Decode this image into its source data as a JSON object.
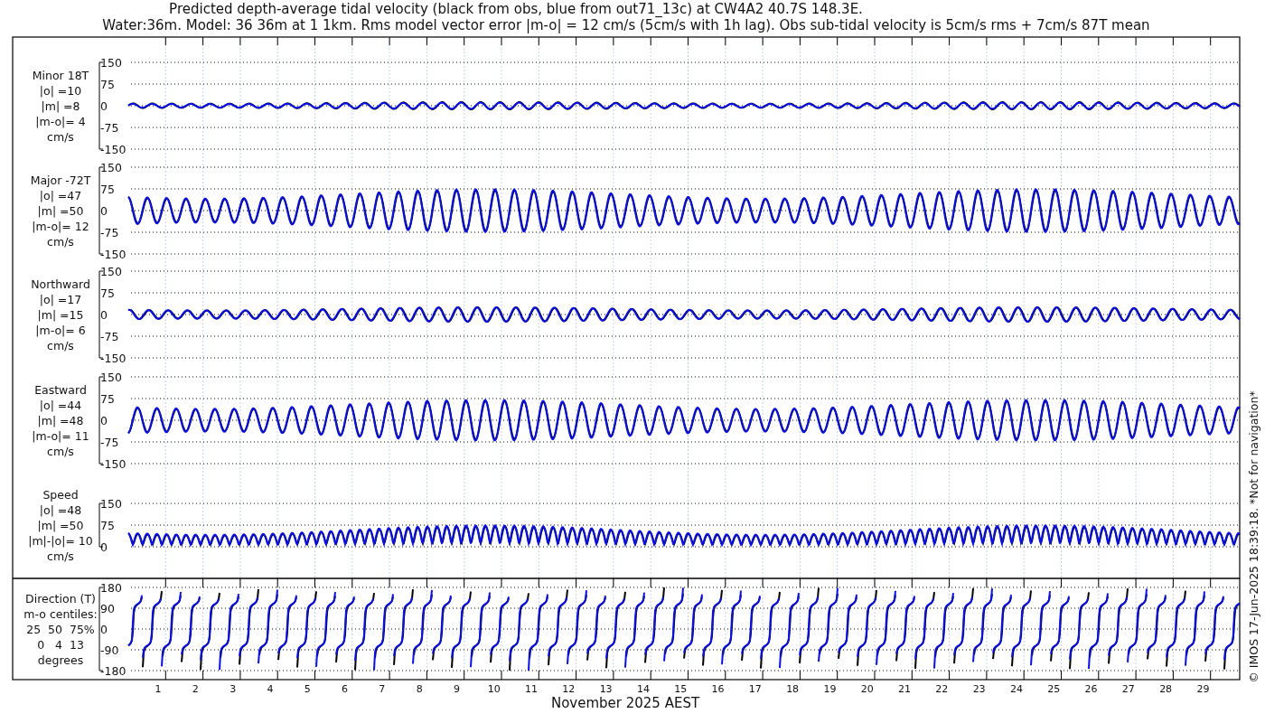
{
  "title": [
    "Predicted depth-average tidal velocity (black from obs, blue from out71_13c) at CW4A2 40.7S 148.3E.",
    "Water:36m. Model: 36 36m at 1 1km. Rms model vector error |m-o| = 12 cm/s (5cm/s with 1h lag). Obs sub-tidal velocity is 5cm/s rms + 7cm/s 87T mean"
  ],
  "panels": [
    {
      "kind": "minor",
      "label": [
        "Minor 18T",
        "|o| =10",
        "|m| =8",
        "|m-o|= 4",
        "cm/s"
      ],
      "yticks": [
        "150",
        "75",
        "0",
        "-75",
        "-150"
      ]
    },
    {
      "kind": "major",
      "label": [
        "Major -72T",
        "|o| =47",
        "|m| =50",
        "|m-o|= 12",
        "cm/s"
      ],
      "yticks": [
        "150",
        "75",
        "0",
        "-75",
        "-150"
      ]
    },
    {
      "kind": "north",
      "label": [
        "Northward",
        "|o| =17",
        "|m| =15",
        "|m-o|= 6",
        "cm/s"
      ],
      "yticks": [
        "150",
        "75",
        "0",
        "-75",
        "-150"
      ]
    },
    {
      "kind": "east",
      "label": [
        "Eastward",
        "|o| =44",
        "|m| =48",
        "|m-o|= 11",
        "cm/s"
      ],
      "yticks": [
        "150",
        "75",
        "0",
        "-75",
        "-150"
      ]
    },
    {
      "kind": "speed",
      "label": [
        "Speed",
        "|o| =48",
        "|m| =50",
        "|m|-|o|= 10",
        "cm/s"
      ],
      "yticks": [
        "150",
        "75",
        "0"
      ]
    },
    {
      "kind": "direction",
      "label": [
        "Direction (T)",
        "m-o centiles:",
        "25  50  75%",
        "0   4  13",
        "degrees"
      ],
      "yticks": [
        "180",
        "90",
        "0",
        "-90",
        "-180"
      ]
    }
  ],
  "xticks": [
    "1",
    "2",
    "3",
    "4",
    "5",
    "6",
    "7",
    "8",
    "9",
    "10",
    "11",
    "12",
    "13",
    "14",
    "15",
    "16",
    "17",
    "18",
    "19",
    "20",
    "21",
    "22",
    "23",
    "24",
    "25",
    "26",
    "27",
    "28",
    "29"
  ],
  "xlabel": "November 2025 AEST",
  "credit": "© IMOS 17-Jun-2025 18:39:18. *Not for navigation*"
}
